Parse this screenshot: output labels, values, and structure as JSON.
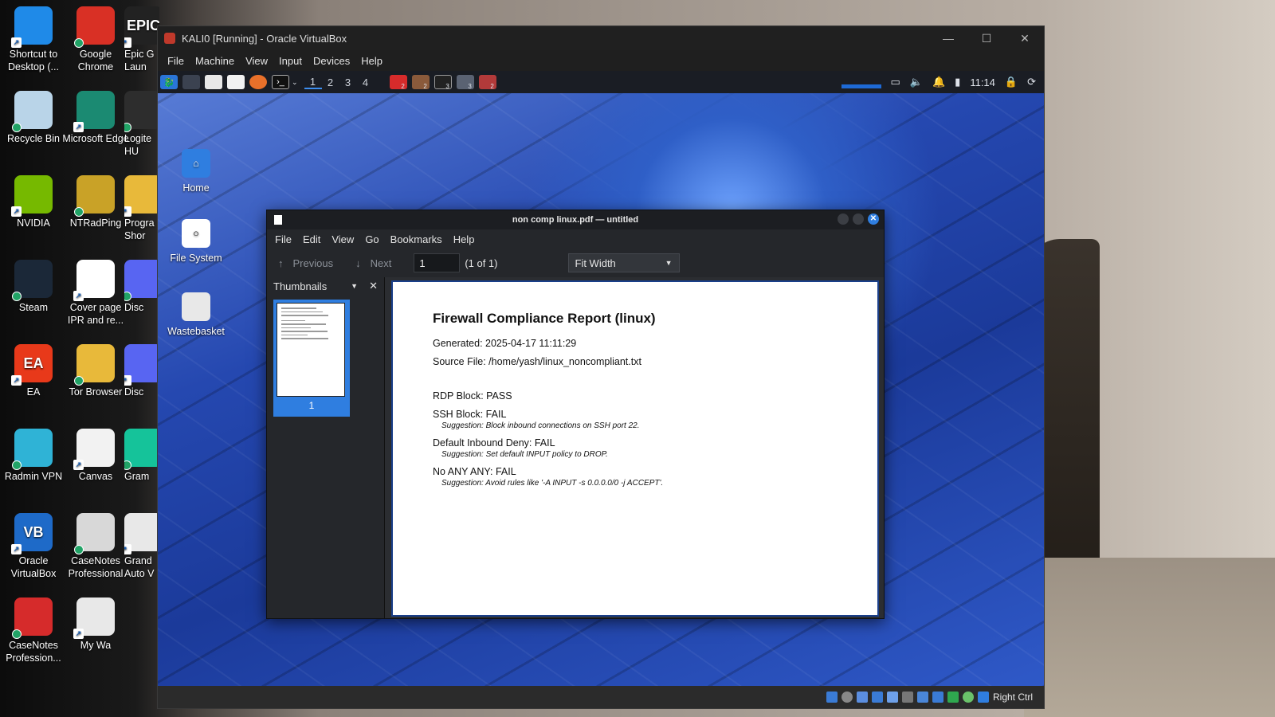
{
  "windows_desktop": {
    "icons": [
      {
        "label": "Shortcut to Desktop (...",
        "icon": "onedrive-icon",
        "color": "#1f8ae8"
      },
      {
        "label": "Google Chrome",
        "icon": "chrome-icon",
        "color": "#d93025"
      },
      {
        "label": "Epic G Laun",
        "icon": "epic-games-icon",
        "color": "#222222",
        "glyph": "EPIC"
      },
      {
        "label": "Recycle Bin",
        "icon": "recycle-bin-icon",
        "color": "#b9d4e8"
      },
      {
        "label": "Microsoft Edge",
        "icon": "edge-icon",
        "color": "#1b8a72"
      },
      {
        "label": "Logite HU",
        "icon": "logitech-icon",
        "color": "#2d2d2d"
      },
      {
        "label": "NVIDIA",
        "icon": "nvidia-icon",
        "color": "#76b900"
      },
      {
        "label": "NTRadPing",
        "icon": "ntradping-icon",
        "color": "#c9a227"
      },
      {
        "label": "Progra Shor",
        "icon": "folder-icon",
        "color": "#e8b93a"
      },
      {
        "label": "Steam",
        "icon": "steam-icon",
        "color": "#1b2838"
      },
      {
        "label": "Cover page IPR and re...",
        "icon": "word-doc-icon",
        "color": "#ffffff"
      },
      {
        "label": "Disc",
        "icon": "discord-icon",
        "color": "#5865f2"
      },
      {
        "label": "EA",
        "icon": "ea-icon",
        "color": "#e8391a",
        "glyph": "EA"
      },
      {
        "label": "Tor Browser",
        "icon": "tor-folder-icon",
        "color": "#e8b93a"
      },
      {
        "label": "Disc",
        "icon": "discord-icon",
        "color": "#5865f2"
      },
      {
        "label": "Radmin VPN",
        "icon": "radmin-vpn-icon",
        "color": "#2fb3d6"
      },
      {
        "label": "Canvas",
        "icon": "file-icon",
        "color": "#f2f2f2"
      },
      {
        "label": "Gram",
        "icon": "grammarly-icon",
        "color": "#15c39a"
      },
      {
        "label": "Oracle VirtualBox",
        "icon": "virtualbox-icon",
        "color": "#1e6ac8",
        "glyph": "VB"
      },
      {
        "label": "CaseNotes Professional",
        "icon": "casenotes-icon",
        "color": "#d8d8d8"
      },
      {
        "label": "Grand Auto V",
        "icon": "gta-icon",
        "color": "#e8e8e8"
      },
      {
        "label": "CaseNotes Profession...",
        "icon": "pdf-file-icon",
        "color": "#d62b2b"
      },
      {
        "label": "My Wa",
        "icon": "file-icon",
        "color": "#e8e8e8"
      }
    ]
  },
  "vbox": {
    "title": "KALI0 [Running] - Oracle VirtualBox",
    "menu": [
      "File",
      "Machine",
      "View",
      "Input",
      "Devices",
      "Help"
    ],
    "host_key": "Right Ctrl"
  },
  "kali": {
    "workspaces": [
      "1",
      "2",
      "3",
      "4"
    ],
    "task_badges": [
      "2",
      "2",
      "3",
      "3",
      "2"
    ],
    "clock": "11:14",
    "desktop_icons": [
      {
        "label": "Home",
        "icon": "home-folder-icon"
      },
      {
        "label": "File System",
        "icon": "hard-drive-icon"
      },
      {
        "label": "Wastebasket",
        "icon": "trash-icon"
      }
    ]
  },
  "pdf_viewer": {
    "title": "non comp linux.pdf — untitled",
    "menu": [
      "File",
      "Edit",
      "View",
      "Go",
      "Bookmarks",
      "Help"
    ],
    "previous_label": "Previous",
    "next_label": "Next",
    "page_value": "1",
    "page_count": "(1 of 1)",
    "zoom": "Fit Width",
    "sidebar_title": "Thumbnails",
    "thumbnail_number": "1"
  },
  "document": {
    "heading": "Firewall Compliance Report (linux)",
    "generated": "Generated: 2025-04-17 11:11:29",
    "source": "Source File: /home/yash/linux_noncompliant.txt",
    "rules": [
      {
        "text": "RDP Block: PASS",
        "suggestion": ""
      },
      {
        "text": "SSH Block: FAIL",
        "suggestion": "Suggestion: Block inbound connections on SSH port 22."
      },
      {
        "text": "Default Inbound Deny: FAIL",
        "suggestion": "Suggestion: Set default INPUT policy to DROP."
      },
      {
        "text": "No ANY ANY: FAIL",
        "suggestion": "Suggestion: Avoid rules like '-A INPUT -s 0.0.0.0/0 -j ACCEPT'."
      }
    ]
  }
}
